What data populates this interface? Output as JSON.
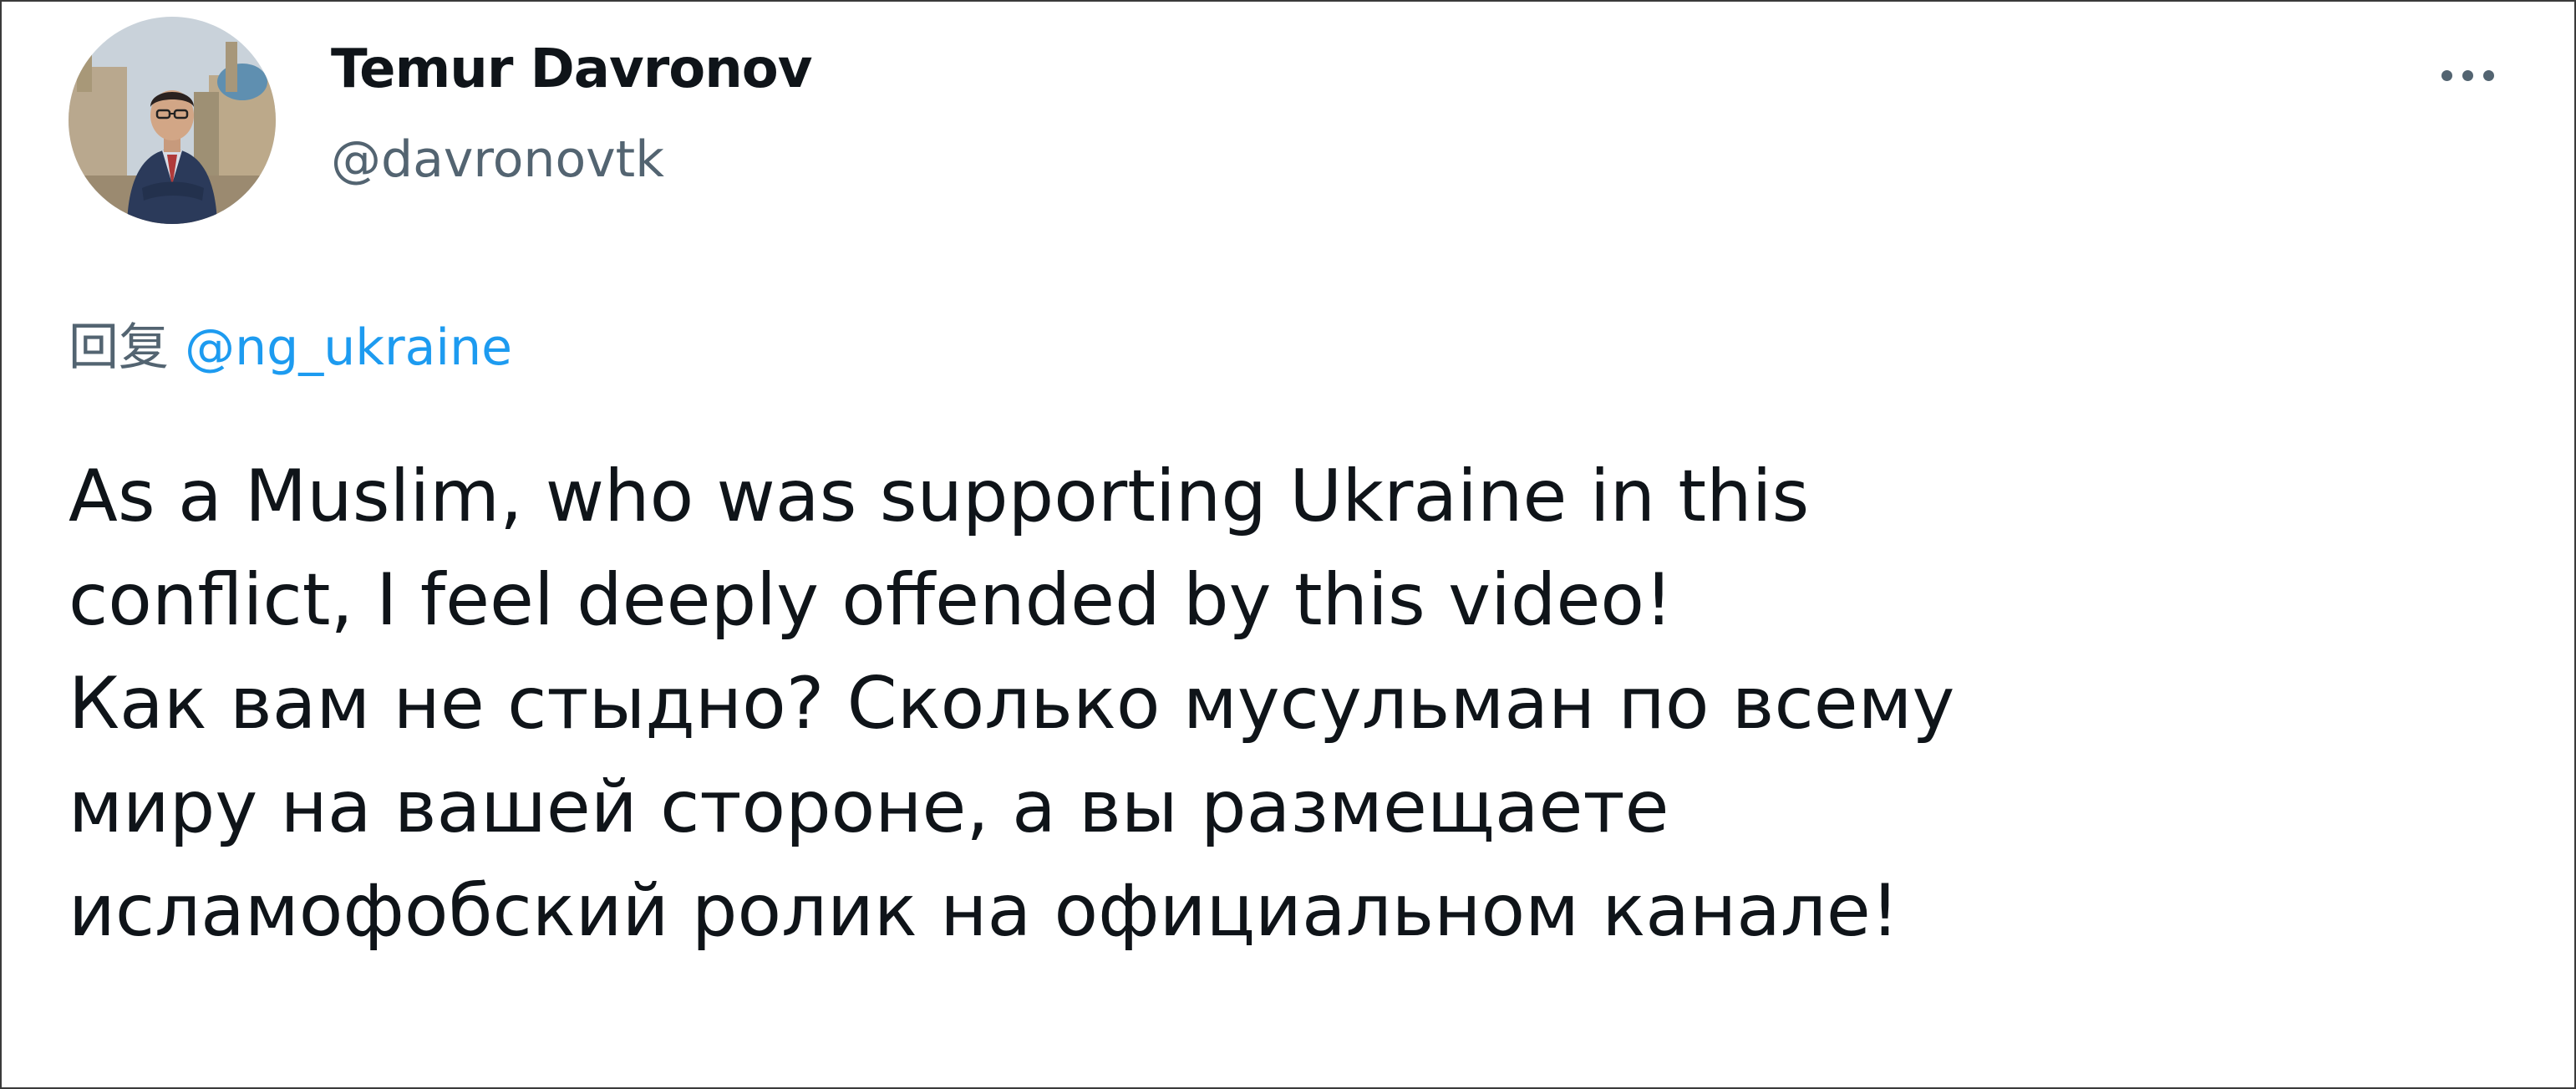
{
  "author": {
    "display_name": "Temur Davronov",
    "handle": "@davronovtk"
  },
  "reply": {
    "prefix": "回复",
    "mention": "@ng_ukraine"
  },
  "tweet": {
    "lines": [
      "As a Muslim, who was supporting Ukraine in this",
      "conflict, I feel deeply offended by this video!",
      "Как вам не стыдно? Сколько мусульман по всему",
      "миру на вашей стороне, а вы размещаете",
      "исламофобский ролик на официальном канале!"
    ]
  },
  "icons": {
    "more": "more-horizontal-icon"
  },
  "colors": {
    "text_primary": "#0f1419",
    "text_secondary": "#536471",
    "link": "#1d9bf0",
    "frame_border": "#3a3a3a"
  }
}
